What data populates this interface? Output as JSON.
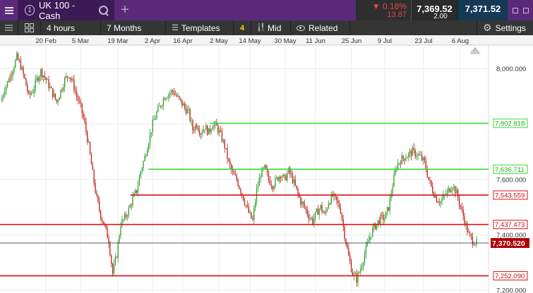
{
  "instrument": {
    "number": "1",
    "name": "UK 100 - Cash"
  },
  "quote": {
    "change_pct": "▼ 0.18%",
    "change_pts": "13.87",
    "sell": "7,369.52",
    "buy": "7,371.52",
    "spread": "2.00"
  },
  "toolbar": {
    "interval": "4 hours",
    "range": "7 Months",
    "templates": "Templates",
    "templates_count": "4",
    "price_type": "Mid",
    "related": "Related",
    "settings": "Settings"
  },
  "chart_data": {
    "type": "candlestick",
    "x_ticks": [
      "20 Feb",
      "5 Mar",
      "19 Mar",
      "2 Apr",
      "16 Apr",
      "2 May",
      "14 May",
      "30 May",
      "11 Jun",
      "25 Jun",
      "9 Jul",
      "23 Jul",
      "6 Aug"
    ],
    "y_ticks": [
      "8,000.000",
      "7,800.000",
      "7,600.000",
      "7,400.000",
      "7,200.000"
    ],
    "ylim": [
      7190,
      8080
    ],
    "current_price": "7,370.520",
    "levels": [
      {
        "label": "7,802.818",
        "value": 7802.818,
        "color": "#33dd33",
        "kind": "support"
      },
      {
        "label": "7,636.711",
        "value": 7636.711,
        "color": "#33dd33",
        "kind": "support"
      },
      {
        "label": "7,543.559",
        "value": 7543.559,
        "color": "#dd1111",
        "kind": "resistance"
      },
      {
        "label": "7,437.473",
        "value": 7437.473,
        "color": "#dd1111",
        "kind": "resistance"
      },
      {
        "label": "7,252.090",
        "value": 7252.09,
        "color": "#dd1111",
        "kind": "resistance"
      }
    ],
    "series": [
      7880,
      7930,
      7960,
      8000,
      8040,
      8010,
      7960,
      7900,
      7920,
      7960,
      7990,
      7970,
      7940,
      7910,
      7880,
      7920,
      7960,
      7980,
      7950,
      7900,
      7860,
      7800,
      7720,
      7620,
      7530,
      7470,
      7430,
      7380,
      7260,
      7330,
      7440,
      7460,
      7490,
      7530,
      7560,
      7630,
      7680,
      7740,
      7800,
      7840,
      7870,
      7900,
      7910,
      7920,
      7900,
      7880,
      7860,
      7840,
      7780,
      7800,
      7770,
      7790,
      7770,
      7800,
      7790,
      7760,
      7720,
      7660,
      7620,
      7600,
      7560,
      7520,
      7480,
      7450,
      7560,
      7620,
      7640,
      7600,
      7580,
      7600,
      7620,
      7600,
      7630,
      7600,
      7560,
      7520,
      7500,
      7470,
      7450,
      7480,
      7500,
      7470,
      7520,
      7540,
      7520,
      7490,
      7400,
      7320,
      7260,
      7240,
      7280,
      7330,
      7380,
      7420,
      7440,
      7460,
      7460,
      7500,
      7580,
      7650,
      7670,
      7680,
      7690,
      7700,
      7690,
      7680,
      7660,
      7600,
      7560,
      7530,
      7520,
      7540,
      7560,
      7580,
      7550,
      7500,
      7450,
      7400,
      7380,
      7370
    ]
  }
}
